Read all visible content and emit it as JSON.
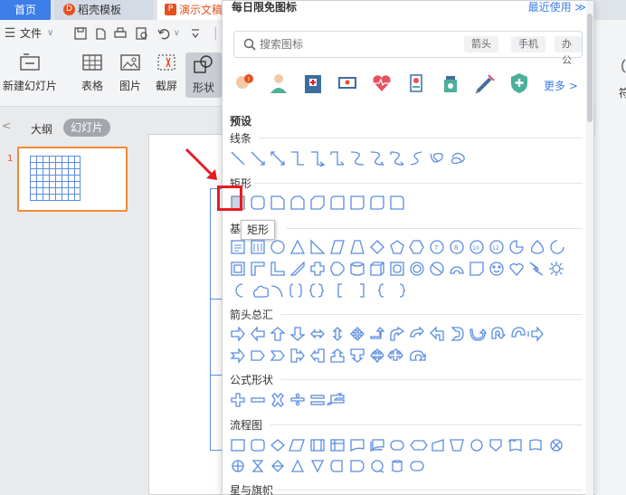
{
  "tabs": {
    "home": "首页",
    "template": "稻壳模板",
    "template_badge": "D",
    "present": "演示文稿",
    "present_badge": "P"
  },
  "menu": {
    "file": "文件",
    "file_arrow": "∨",
    "more_arrow": "∨"
  },
  "ribbon": {
    "new_slide": "新建幻灯片",
    "table": "表格",
    "image": "图片",
    "screenshot": "截屏",
    "shape": "形状",
    "right_partial": "符"
  },
  "left_panel": {
    "collapse": "<",
    "outline": "大纲",
    "slides": "幻灯片",
    "slide_number": "1"
  },
  "panel": {
    "title": "每日限免图标",
    "free_use": "最近使用 ≫",
    "search_placeholder": "搜索图标",
    "chips": [
      "箭头",
      "手机",
      "办公"
    ],
    "more": "更多 >",
    "preset": "预设",
    "sections": {
      "lines": "线条",
      "rect": "矩形",
      "basic": "基",
      "arrows": "箭头总汇",
      "formula": "公式形状",
      "flowchart": "流程图",
      "stars": "星与旗帜"
    },
    "tooltip": "矩形"
  },
  "colors": {
    "accent": "#3e7ee8",
    "brand": "#e8501f",
    "highlight": "#e51c23",
    "shape_stroke": "#5b8de0"
  },
  "icons": [
    "search-icon",
    "user-alert-icon",
    "doctor-icon",
    "hospital-icon",
    "online-consult-icon",
    "heart-monitor-icon",
    "clinic-icon",
    "pill-bottle-icon",
    "syringe-icon",
    "shield-medical-icon"
  ]
}
